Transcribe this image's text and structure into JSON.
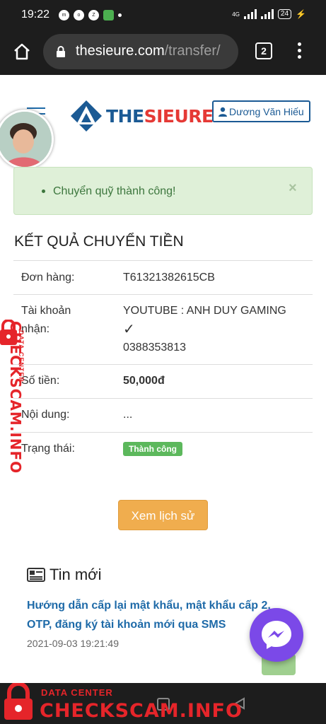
{
  "status_bar": {
    "time": "19:22",
    "network": "4G",
    "battery": "24"
  },
  "browser": {
    "url_domain": "thesieure.com",
    "url_path": "/transfer/",
    "tab_count": "2"
  },
  "header": {
    "logo_text_a": "THE",
    "logo_text_b": "SIEURE",
    "user_name": "Dương Văn Hiếu"
  },
  "alert": {
    "message": "Chuyển quỹ thành công!",
    "close_symbol": "×"
  },
  "result": {
    "heading": "KẾT QUẢ CHUYỂN TIỀN",
    "order_label": "Đơn hàng:",
    "order_value": "T61321382615CB",
    "account_label": "Tài khoản nhận:",
    "account_name": "YOUTUBE : ANH DUY GAMING",
    "account_check": "✓",
    "account_phone": "0388353813",
    "amount_label": "Số tiền:",
    "amount_value": "50,000đ",
    "content_label": "Nội dung:",
    "content_value": "...",
    "status_label": "Trạng thái:",
    "status_value": "Thành công"
  },
  "history_button": "Xem lịch sử",
  "news": {
    "heading": "Tin mới",
    "title": "Hướng dẫn cấp lại mật khẩu, mật khẩu cấp 2, OTP, đăng ký tài khoản mới qua SMS",
    "date": "2021-09-03 19:21:49"
  },
  "watermark": {
    "side_big": "CHECKSCAM.INFO",
    "side_small": "DATA CENTER",
    "bottom_small": "DATA CENTER",
    "bottom_big": "CHECKSCAM.INFO"
  },
  "colors": {
    "brand_blue": "#1b5a94",
    "brand_red": "#e53935",
    "success_bg": "#dff0d8",
    "success_text": "#3c763d",
    "button_orange": "#f0ad4e",
    "badge_green": "#5cb85c",
    "watermark_red": "#e5252a"
  }
}
